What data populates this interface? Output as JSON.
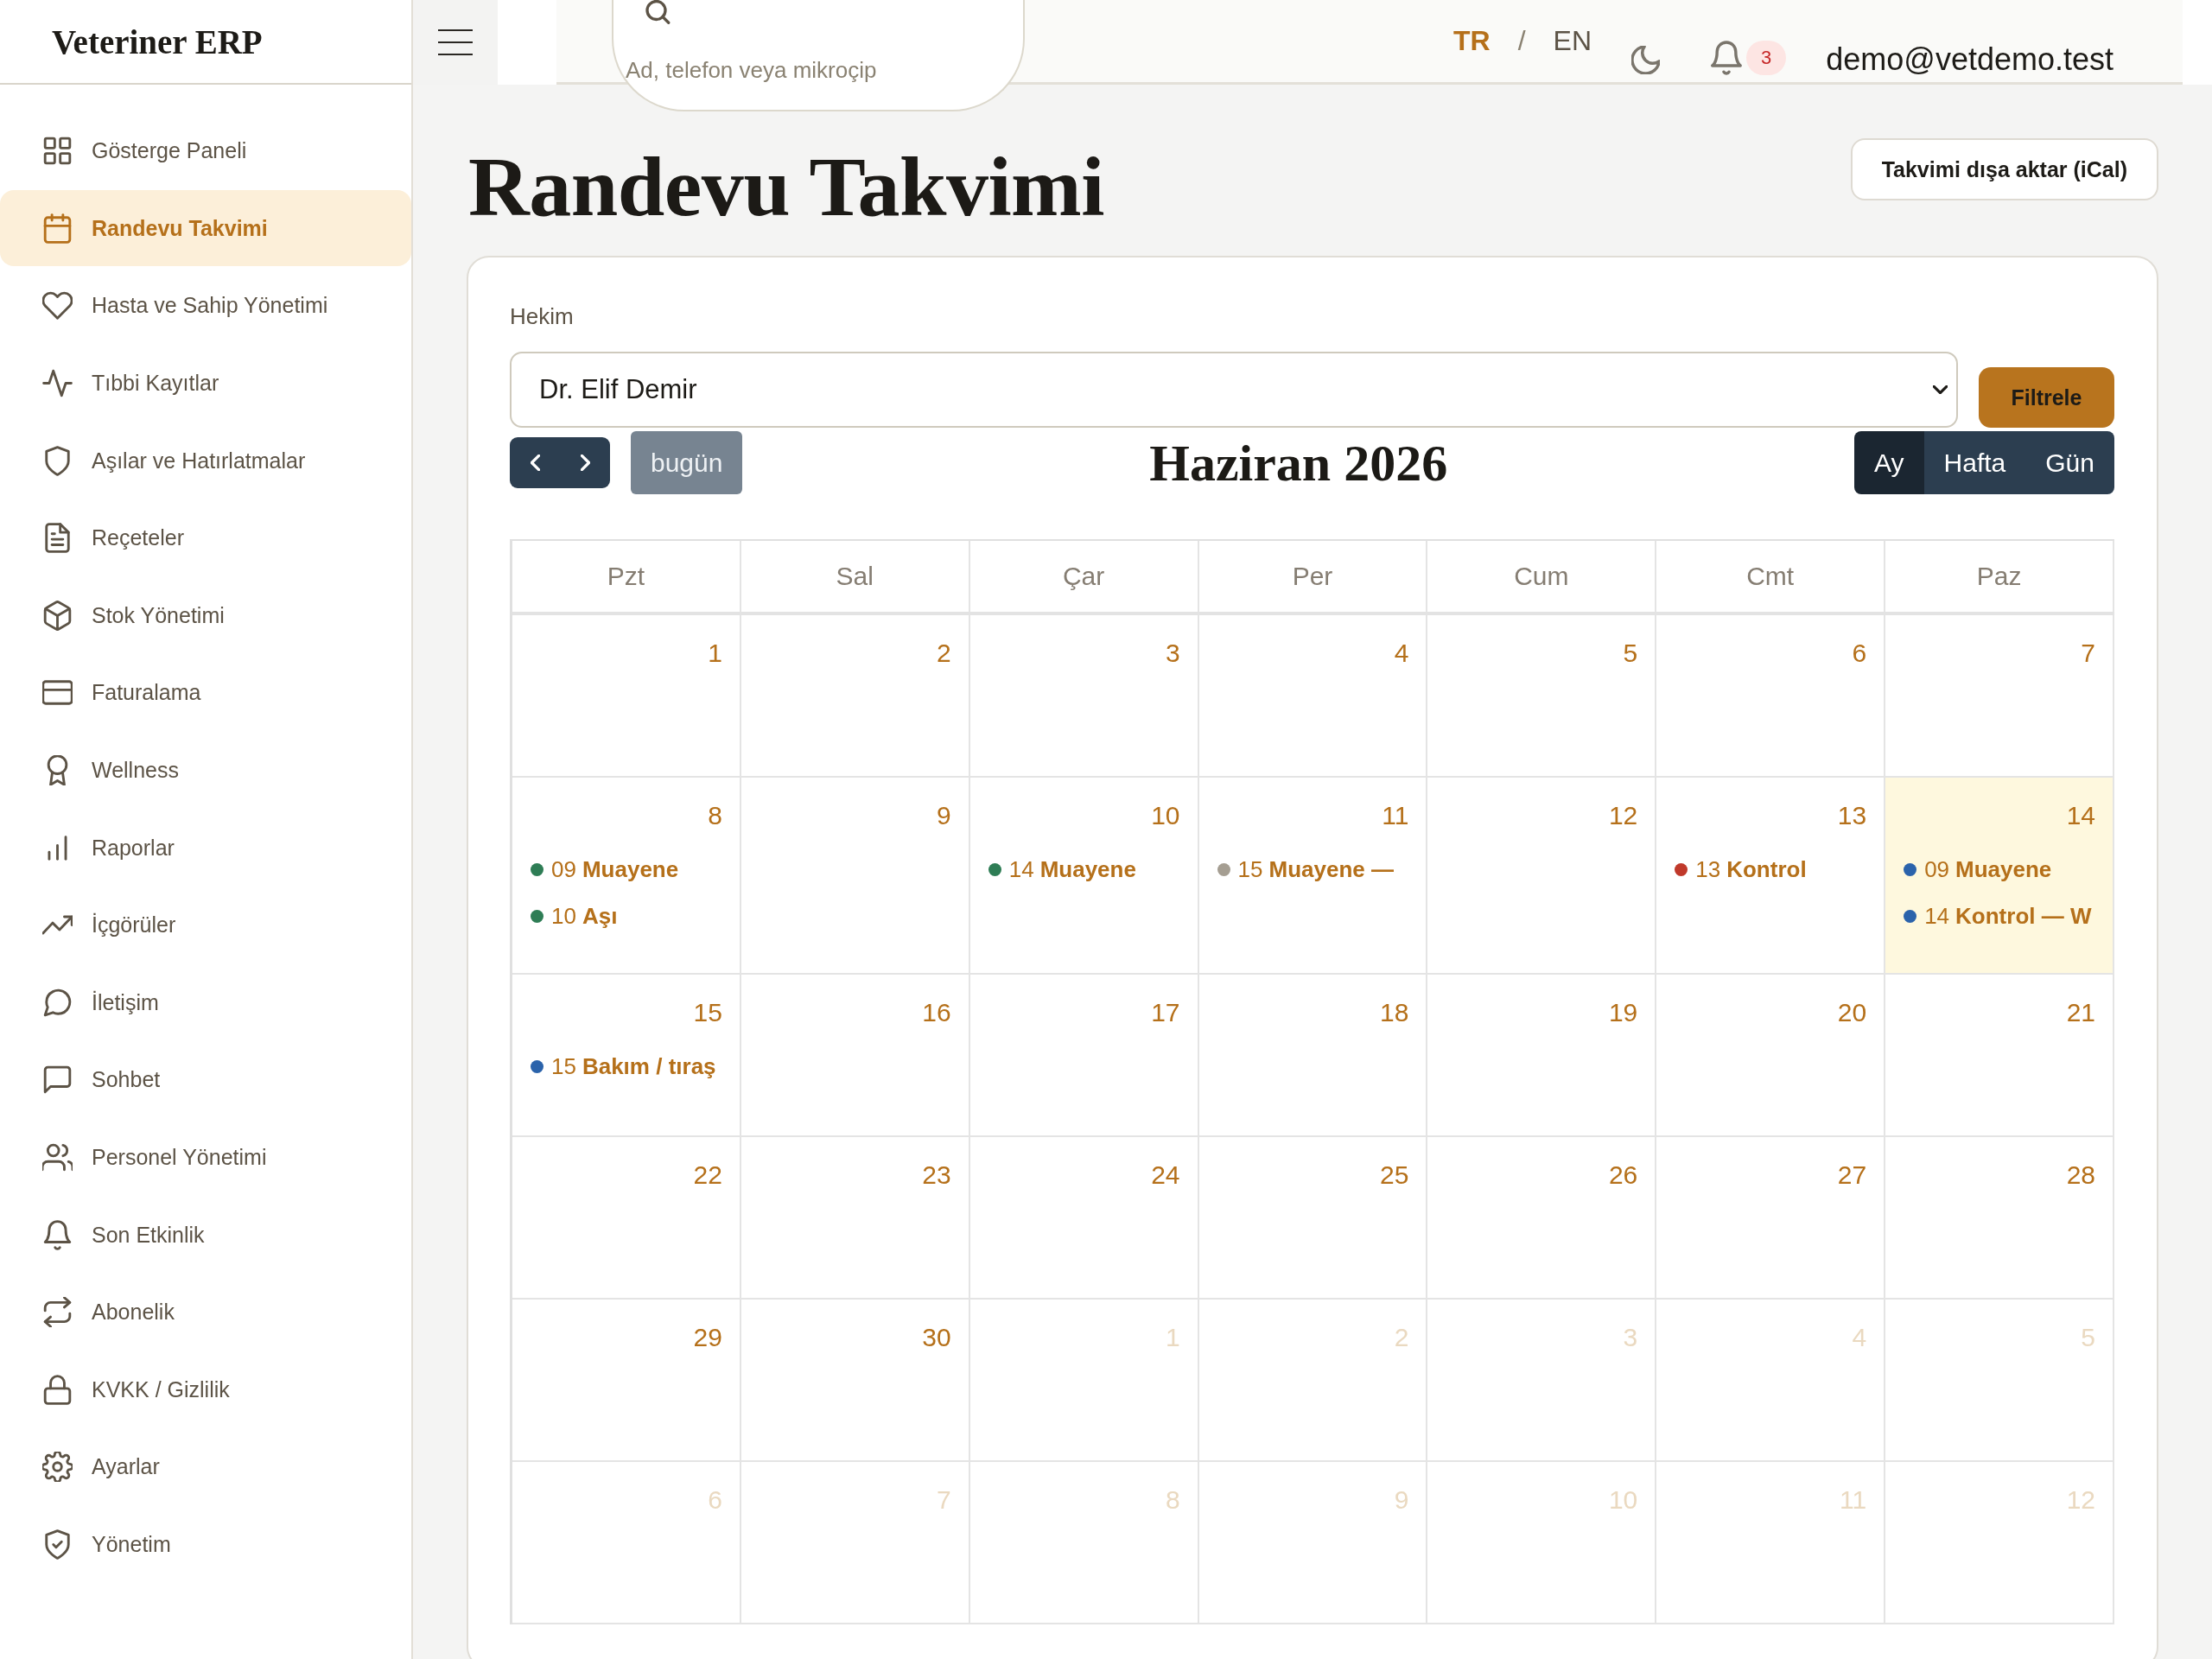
{
  "sidebar": {
    "logo": "Veteriner ERP",
    "items": [
      {
        "label": "Gösterge Paneli",
        "selected": false
      },
      {
        "label": "Randevu Takvimi",
        "selected": true
      },
      {
        "label": "Hasta ve Sahip Yönetimi",
        "selected": false
      },
      {
        "label": "Tıbbi Kayıtlar",
        "selected": false
      },
      {
        "label": "Aşılar ve Hatırlatmalar",
        "selected": false
      },
      {
        "label": "Reçeteler",
        "selected": false
      },
      {
        "label": "Stok Yönetimi",
        "selected": false
      },
      {
        "label": "Faturalama",
        "selected": false
      },
      {
        "label": "Wellness",
        "selected": false
      },
      {
        "label": "Raporlar",
        "selected": false
      },
      {
        "label": "İçgörüler",
        "selected": false
      },
      {
        "label": "İletişim",
        "selected": false
      },
      {
        "label": "Sohbet",
        "selected": false
      },
      {
        "label": "Personel Yönetimi",
        "selected": false
      },
      {
        "label": "Son Etkinlik",
        "selected": false
      },
      {
        "label": "Abonelik",
        "selected": false
      },
      {
        "label": "KVKK / Gizlilik",
        "selected": false
      },
      {
        "label": "Ayarlar",
        "selected": false
      },
      {
        "label": "Yönetim",
        "selected": false
      }
    ]
  },
  "topbar": {
    "search": {
      "placeholder": "Ad, telefon veya mikroçip"
    },
    "languages": [
      {
        "label": "TR",
        "selected": true
      },
      {
        "label": "EN",
        "selected": false
      }
    ],
    "language_separator": "/",
    "notification_count": "3",
    "user_email": "demo@vetdemo.test"
  },
  "page": {
    "title": "Randevu Takvimi",
    "export_button": "Takvimi dışa aktar (iCal)"
  },
  "filter": {
    "label": "Hekim",
    "value": "Dr. Elif Demir",
    "button": "Filtrele"
  },
  "calendar": {
    "title": "Haziran 2026",
    "today_button": {
      "label": "bugün",
      "disabled": true
    },
    "views": [
      {
        "label": "Ay",
        "selected": true
      },
      {
        "label": "Hafta",
        "selected": false
      },
      {
        "label": "Gün",
        "selected": false
      }
    ],
    "weekdays": [
      "Pzt",
      "Sal",
      "Çar",
      "Per",
      "Cum",
      "Cmt",
      "Paz"
    ],
    "weeks": [
      [
        {
          "day": "1",
          "other_month": false,
          "today": false
        },
        {
          "day": "2",
          "other_month": false,
          "today": false
        },
        {
          "day": "3",
          "other_month": false,
          "today": false
        },
        {
          "day": "4",
          "other_month": false,
          "today": false
        },
        {
          "day": "5",
          "other_month": false,
          "today": false
        },
        {
          "day": "6",
          "other_month": false,
          "today": false
        },
        {
          "day": "7",
          "other_month": false,
          "today": false
        }
      ],
      [
        {
          "day": "8",
          "other_month": false,
          "today": false,
          "events": [
            {
              "time": "09",
              "title": "Muayene",
              "color": "#2e7d55"
            },
            {
              "time": "10",
              "title": "Aşı",
              "color": "#2e7d55"
            }
          ]
        },
        {
          "day": "9",
          "other_month": false,
          "today": false
        },
        {
          "day": "10",
          "other_month": false,
          "today": false,
          "events": [
            {
              "time": "14",
              "title": "Muayene",
              "color": "#2e7d55"
            }
          ]
        },
        {
          "day": "11",
          "other_month": false,
          "today": false,
          "events": [
            {
              "time": "15",
              "title": "Muayene —",
              "color": "#a59e92"
            }
          ]
        },
        {
          "day": "12",
          "other_month": false,
          "today": false
        },
        {
          "day": "13",
          "other_month": false,
          "today": false,
          "events": [
            {
              "time": "13",
              "title": "Kontrol",
              "color": "#c0392b"
            }
          ]
        },
        {
          "day": "14",
          "other_month": false,
          "today": true,
          "events": [
            {
              "time": "09",
              "title": "Muayene",
              "color": "#2b63ab"
            },
            {
              "time": "14",
              "title": "Kontrol — W",
              "color": "#2b63ab"
            }
          ]
        }
      ],
      [
        {
          "day": "15",
          "other_month": false,
          "today": false,
          "events": [
            {
              "time": "15",
              "title": "Bakım / tıraş",
              "color": "#2b63ab"
            }
          ]
        },
        {
          "day": "16",
          "other_month": false,
          "today": false
        },
        {
          "day": "17",
          "other_month": false,
          "today": false
        },
        {
          "day": "18",
          "other_month": false,
          "today": false
        },
        {
          "day": "19",
          "other_month": false,
          "today": false
        },
        {
          "day": "20",
          "other_month": false,
          "today": false
        },
        {
          "day": "21",
          "other_month": false,
          "today": false
        }
      ],
      [
        {
          "day": "22",
          "other_month": false,
          "today": false
        },
        {
          "day": "23",
          "other_month": false,
          "today": false
        },
        {
          "day": "24",
          "other_month": false,
          "today": false
        },
        {
          "day": "25",
          "other_month": false,
          "today": false
        },
        {
          "day": "26",
          "other_month": false,
          "today": false
        },
        {
          "day": "27",
          "other_month": false,
          "today": false
        },
        {
          "day": "28",
          "other_month": false,
          "today": false
        }
      ],
      [
        {
          "day": "29",
          "other_month": false,
          "today": false
        },
        {
          "day": "30",
          "other_month": false,
          "today": false
        },
        {
          "day": "1",
          "other_month": true,
          "today": false
        },
        {
          "day": "2",
          "other_month": true,
          "today": false
        },
        {
          "day": "3",
          "other_month": true,
          "today": false
        },
        {
          "day": "4",
          "other_month": true,
          "today": false
        },
        {
          "day": "5",
          "other_month": true,
          "today": false
        }
      ],
      [
        {
          "day": "6",
          "other_month": true,
          "today": false
        },
        {
          "day": "7",
          "other_month": true,
          "today": false
        },
        {
          "day": "8",
          "other_month": true,
          "today": false
        },
        {
          "day": "9",
          "other_month": true,
          "today": false
        },
        {
          "day": "10",
          "other_month": true,
          "today": false
        },
        {
          "day": "11",
          "other_month": true,
          "today": false
        },
        {
          "day": "12",
          "other_month": true,
          "today": false
        }
      ]
    ]
  }
}
